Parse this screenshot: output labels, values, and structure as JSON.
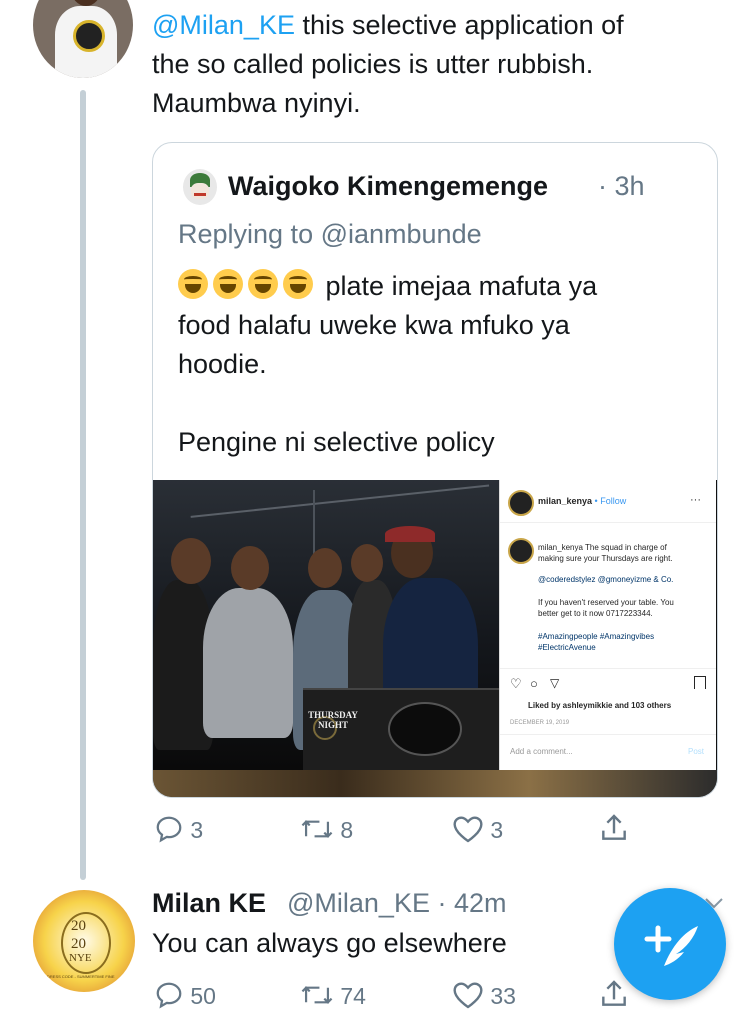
{
  "tweet": {
    "mention": "@Milan_KE",
    "line1_rest": " this selective application of",
    "line2": "the so called policies is utter rubbish.",
    "line3": "Maumbwa nyinyi."
  },
  "quote": {
    "name": "Waigoko Kimengemenge",
    "time": "· 3h",
    "replying_prefix": "Replying to ",
    "replying_handle": "@ianmbunde",
    "line1": "plate imejaa mafuta ya",
    "line2": "food halafu uweke kwa mfuko ya",
    "line3": "hoodie.",
    "line4": "Pengine ni selective policy",
    "image": {
      "photo_caption": "THURSDAY NIGHT",
      "ig_user": "milan_kenya",
      "ig_follow": "• Follow",
      "ig_more": "···",
      "ig_caption_1": "milan_kenya The squad in charge of",
      "ig_caption_2": "making sure your Thursdays are right.",
      "ig_caption_3": "@coderedstylez @gmoneyizme & Co.",
      "ig_caption_4": "If you haven't reserved your table. You",
      "ig_caption_5": "better get to it now 0717223344.",
      "ig_caption_6": "#Amazingpeople #Amazingvibes",
      "ig_caption_7": "#ElectricAvenue",
      "ig_liked": "Liked by ashleymikkie and 103 others",
      "ig_date": "DECEMBER 19, 2019",
      "ig_comment_placeholder": "Add a comment...",
      "ig_post": "Post"
    }
  },
  "actions": {
    "replies": "3",
    "retweets": "8",
    "likes": "3"
  },
  "reply": {
    "name": "Milan KE",
    "handle": "@Milan_KE · 42m",
    "text": "You can always go elsewhere",
    "avatar_text_top": "20",
    "avatar_text_mid": "20",
    "avatar_text_bot": "NYE",
    "avatar_caption": "DRESS CODE - SUMMERTIME FINE",
    "replies": "50",
    "retweets": "74",
    "likes": "33"
  },
  "icons": {
    "reply": "reply-icon",
    "retweet": "retweet-icon",
    "like": "heart-icon",
    "share": "share-icon",
    "compose": "compose-tweet-icon",
    "more": "chevron-down-icon"
  },
  "colors": {
    "accent": "#1da1f2",
    "muted": "#657786",
    "text": "#14171a",
    "thread_line": "#c4cfd6"
  }
}
